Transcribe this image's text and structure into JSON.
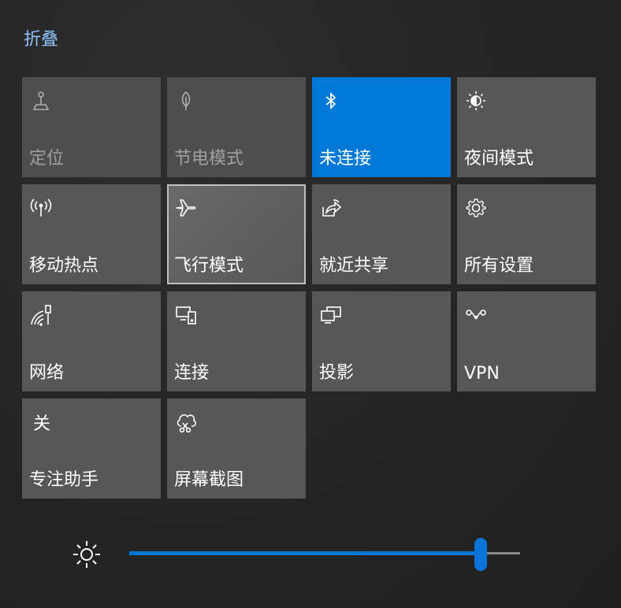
{
  "header": {
    "collapse_label": "折叠"
  },
  "tiles": [
    {
      "label": "定位",
      "icon": "location-icon",
      "state": "disabled"
    },
    {
      "label": "节电模式",
      "icon": "battery-saver-icon",
      "state": "disabled"
    },
    {
      "label": "未连接",
      "icon": "bluetooth-icon",
      "state": "on"
    },
    {
      "label": "夜间模式",
      "icon": "night-light-icon",
      "state": "off"
    },
    {
      "label": "移动热点",
      "icon": "mobile-hotspot-icon",
      "state": "off"
    },
    {
      "label": "飞行模式",
      "icon": "airplane-icon",
      "state": "off"
    },
    {
      "label": "就近共享",
      "icon": "nearby-sharing-icon",
      "state": "off"
    },
    {
      "label": "所有设置",
      "icon": "gear-icon",
      "state": "off"
    },
    {
      "label": "网络",
      "icon": "network-icon",
      "state": "off"
    },
    {
      "label": "连接",
      "icon": "connect-icon",
      "state": "off"
    },
    {
      "label": "投影",
      "icon": "project-icon",
      "state": "off"
    },
    {
      "label": "VPN",
      "icon": "vpn-icon",
      "state": "off"
    },
    {
      "label": "专注助手",
      "icon_text": "关",
      "state": "off"
    },
    {
      "label": "屏幕截图",
      "icon": "screen-snip-icon",
      "state": "off"
    }
  ],
  "brightness": {
    "icon": "brightness-icon",
    "value": 0.9
  },
  "colors": {
    "accent": "#0078d7",
    "tile": "#575757",
    "link": "#8fc3ff"
  }
}
